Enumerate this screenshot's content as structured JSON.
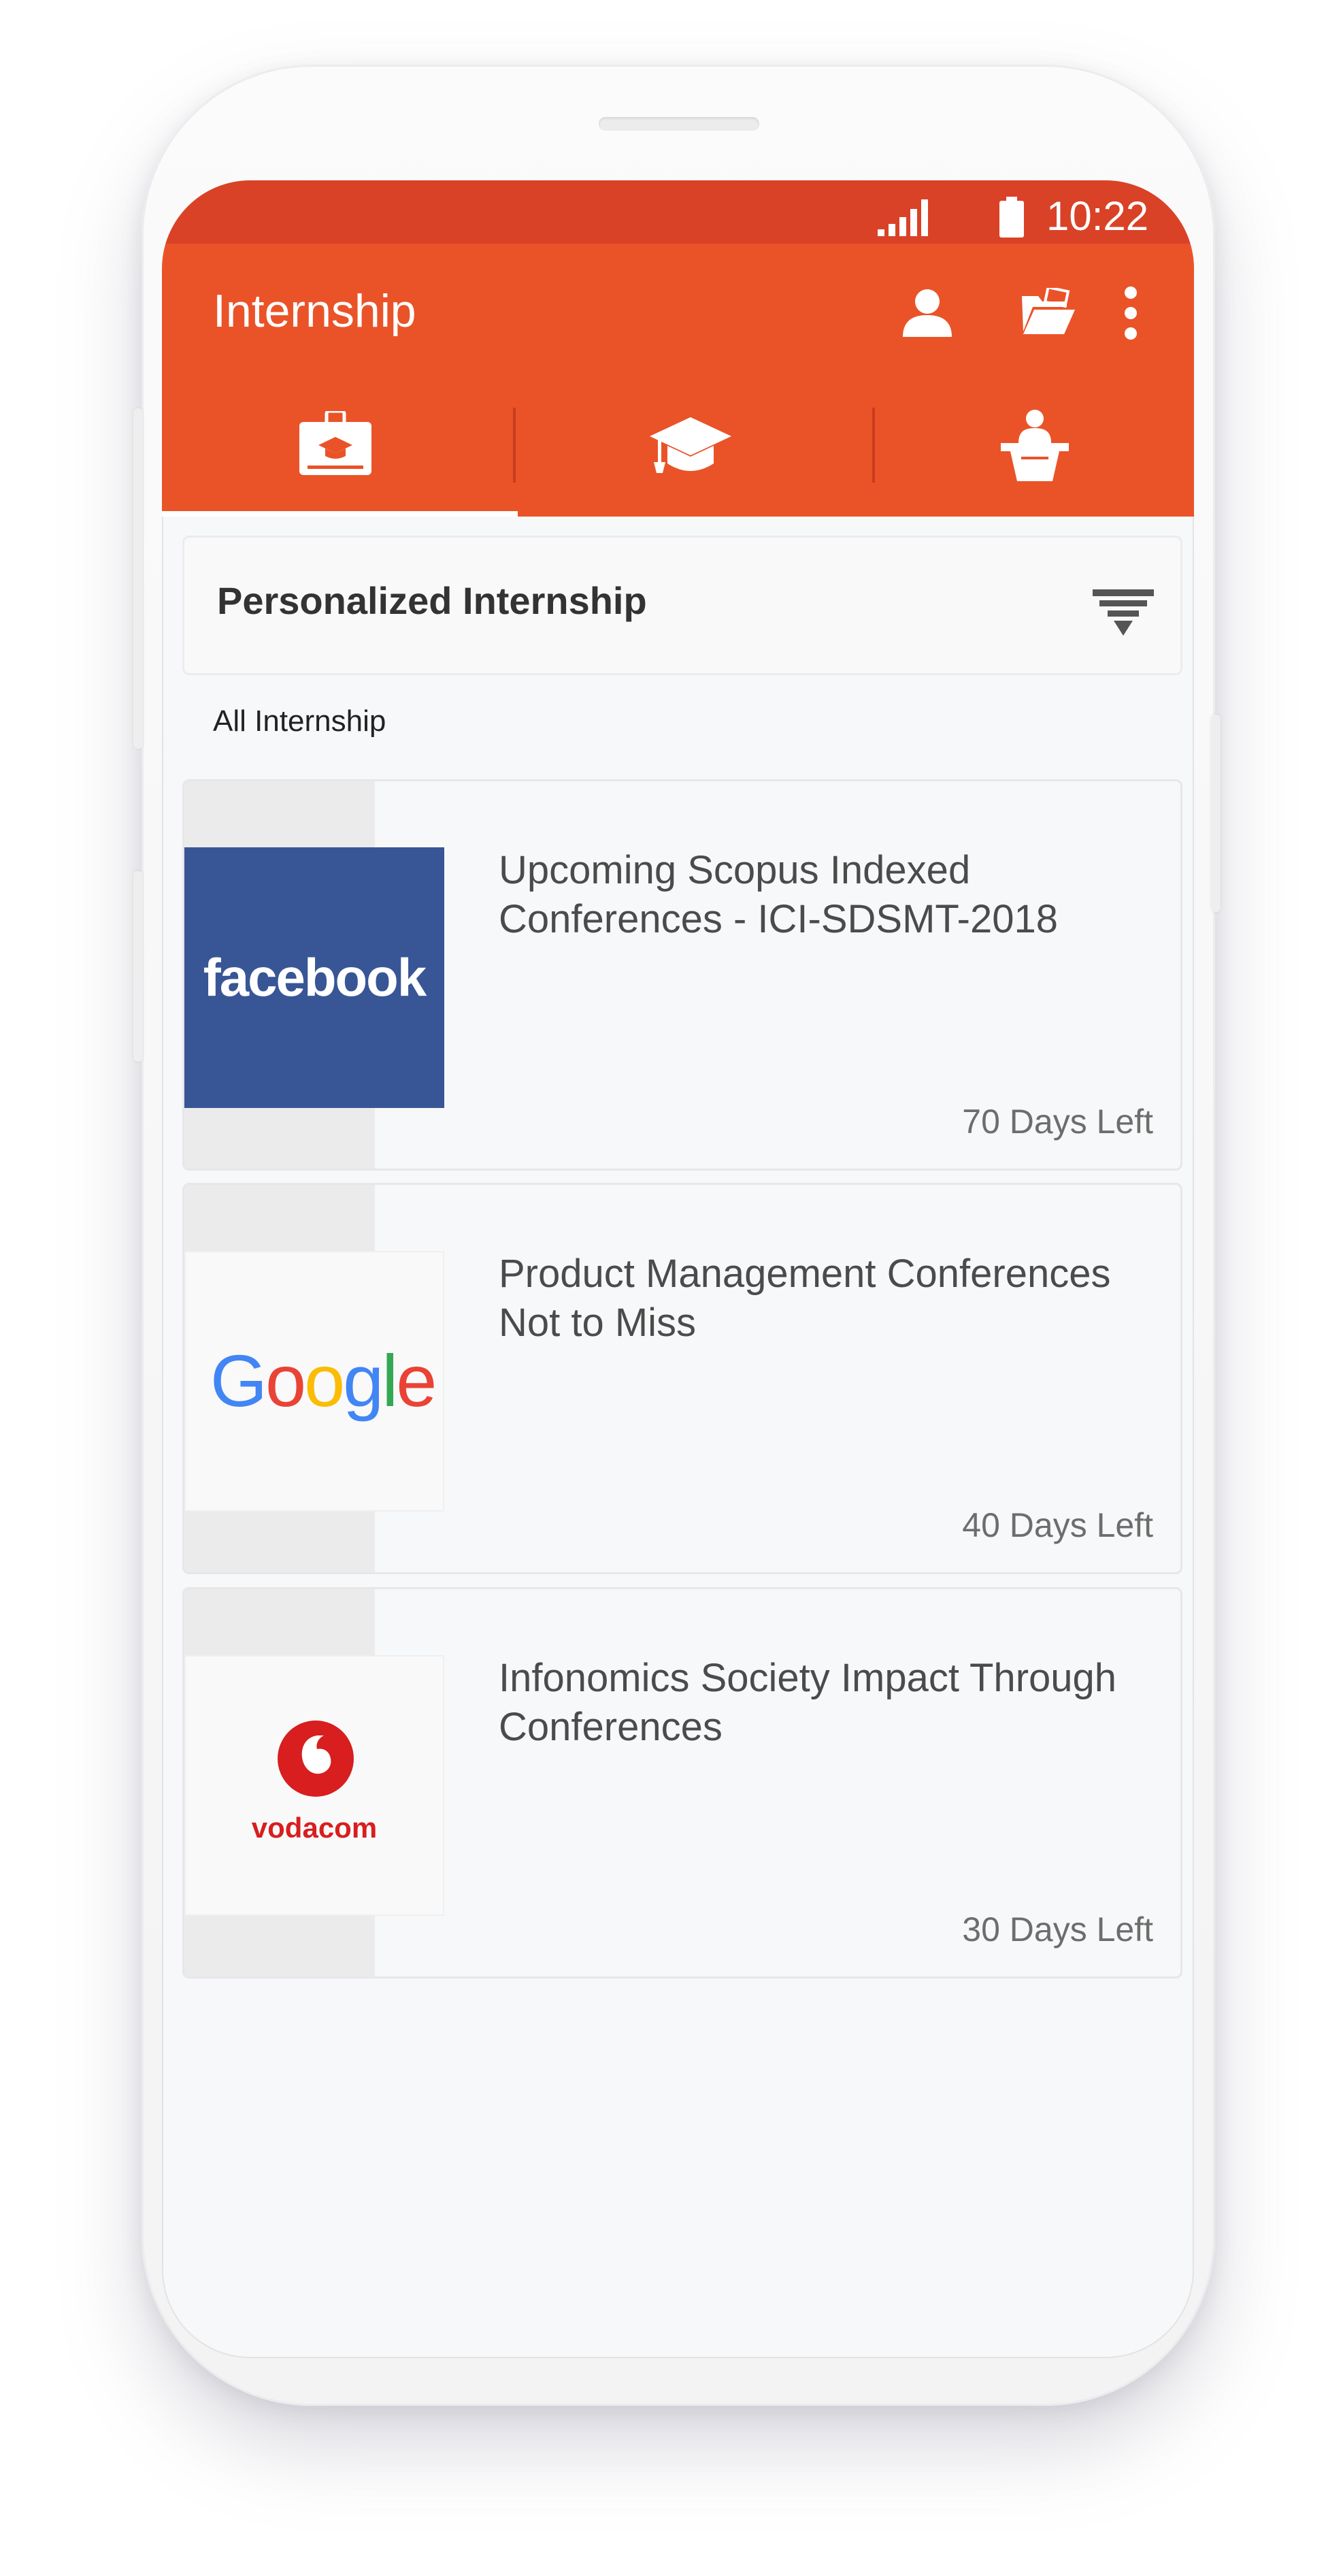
{
  "status_bar": {
    "time": "10:22",
    "signal_icon": "signal-icon",
    "battery_icon": "battery-icon"
  },
  "app_bar": {
    "title": "Internship",
    "actions": [
      {
        "name": "profile",
        "icon": "person-icon"
      },
      {
        "name": "folder",
        "icon": "folder-open-icon"
      },
      {
        "name": "more",
        "icon": "more-vert-icon"
      }
    ]
  },
  "tabs": [
    {
      "name": "internship",
      "icon": "id-badge-icon",
      "selected": true
    },
    {
      "name": "education",
      "icon": "graduation-cap-icon",
      "selected": false
    },
    {
      "name": "conferences",
      "icon": "speaker-podium-icon",
      "selected": false
    }
  ],
  "filter": {
    "title": "Personalized Internship",
    "icon": "filter-icon"
  },
  "section_label": "All Internship",
  "cards": [
    {
      "logo": "facebook",
      "logo_text": "facebook",
      "title": "Upcoming Scopus Indexed Conferences - ICI-SDSMT-2018",
      "deadline": "70 Days Left"
    },
    {
      "logo": "google",
      "logo_text": "Google",
      "title": "Product Management Conferences Not to Miss",
      "deadline": "40 Days Left"
    },
    {
      "logo": "vodacom",
      "logo_text": "vodacom",
      "title": "Infonomics Society Impact Through Conferences",
      "deadline": "30 Days Left"
    }
  ],
  "colors": {
    "primary": "#ea5328",
    "status_bar": "#d94226",
    "facebook": "#385696",
    "vodacom": "#d81e1e"
  }
}
